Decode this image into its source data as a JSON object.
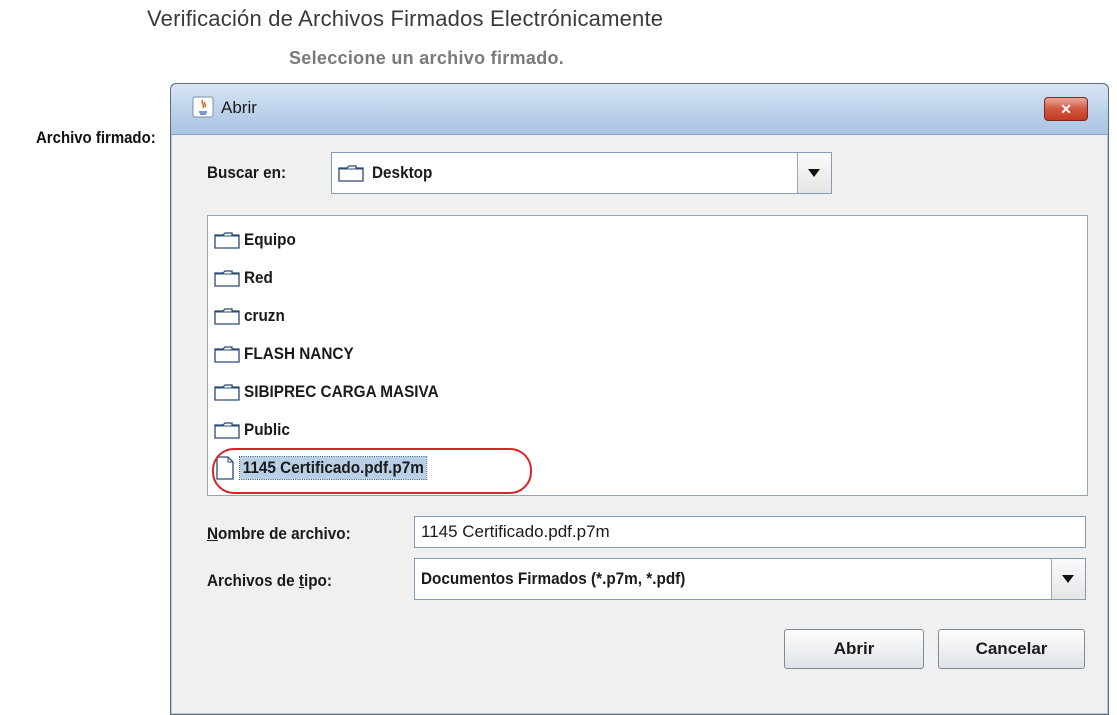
{
  "page": {
    "title": "Verificación de Archivos Firmados Electrónicamente",
    "subtitle": "Seleccione un archivo firmado.",
    "field_label": "Archivo firmado:"
  },
  "dialog": {
    "title": "Abrir",
    "close_label": "✕",
    "look_in": {
      "label": "Buscar en:",
      "value": "Desktop"
    },
    "toolbar": {
      "buttons": [
        "up-one-level",
        "home",
        "new-folder",
        "list-view",
        "details-view"
      ]
    },
    "files": [
      {
        "name": "Equipo",
        "type": "folder"
      },
      {
        "name": "Red",
        "type": "folder"
      },
      {
        "name": "cruzn",
        "type": "folder"
      },
      {
        "name": "FLASH NANCY",
        "type": "folder"
      },
      {
        "name": "SIBIPREC CARGA MASIVA",
        "type": "folder"
      },
      {
        "name": "Public",
        "type": "folder"
      },
      {
        "name": "1145 Certificado.pdf.p7m",
        "type": "file",
        "selected": true
      }
    ],
    "filename": {
      "label_mnemonic": "N",
      "label_rest": "ombre de archivo:",
      "value": "1145 Certificado.pdf.p7m"
    },
    "filetype": {
      "label_pre": "Archivos de ",
      "label_mnemonic": "t",
      "label_post": "ipo:",
      "value": "Documentos Firmados (*.p7m, *.pdf)"
    },
    "buttons": {
      "open": "Abrir",
      "cancel": "Cancelar"
    }
  },
  "colors": {
    "selection": "#b8cfe5",
    "annotation_ring": "#d8232a",
    "close_button": "#c23a20"
  }
}
